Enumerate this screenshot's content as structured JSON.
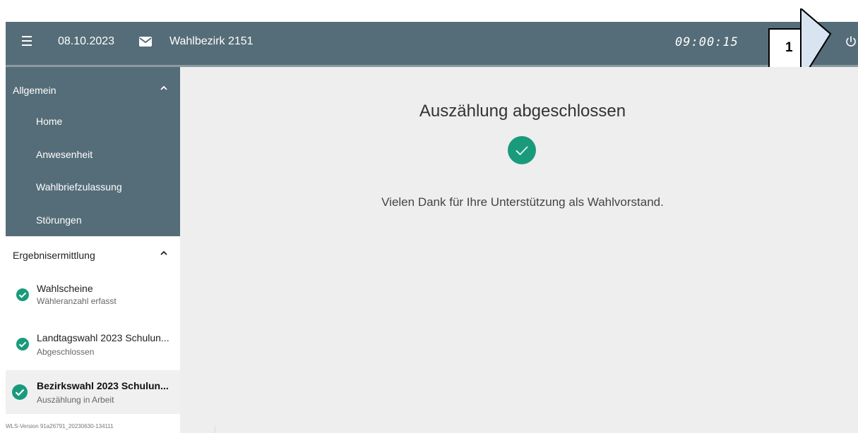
{
  "topbar": {
    "date": "08.10.2023",
    "district": "Wahlbezirk 2151",
    "clock": "09:00:15",
    "icons": [
      "menu-icon",
      "mail-icon",
      "power-icon"
    ]
  },
  "callout": {
    "label": "1"
  },
  "sidebar": {
    "group1": {
      "label": "Allgemein",
      "items": [
        "Home",
        "Anwesenheit",
        "Wahlbriefzulassung",
        "Störungen"
      ]
    },
    "group2": {
      "label": "Ergebnisermittlung",
      "steps": [
        {
          "title": "Wahlscheine",
          "subtitle": "Wähleranzahl erfasst"
        },
        {
          "title": "Landtagswahl 2023 Schulun...",
          "subtitle": "Abgeschlossen"
        },
        {
          "title": "Bezirkswahl 2023 Schulun...",
          "subtitle": "Auszählung in Arbeit"
        }
      ]
    },
    "version": "WLS-Version 91a26791_20230630-134111"
  },
  "main": {
    "headline": "Auszählung abgeschlossen",
    "message": "Vielen Dank für Ihre Unterstützung als Wahlvorstand."
  },
  "colors": {
    "topbar": "#556d78",
    "accent": "#1a9a7c",
    "main_bg": "#eeeeee"
  }
}
